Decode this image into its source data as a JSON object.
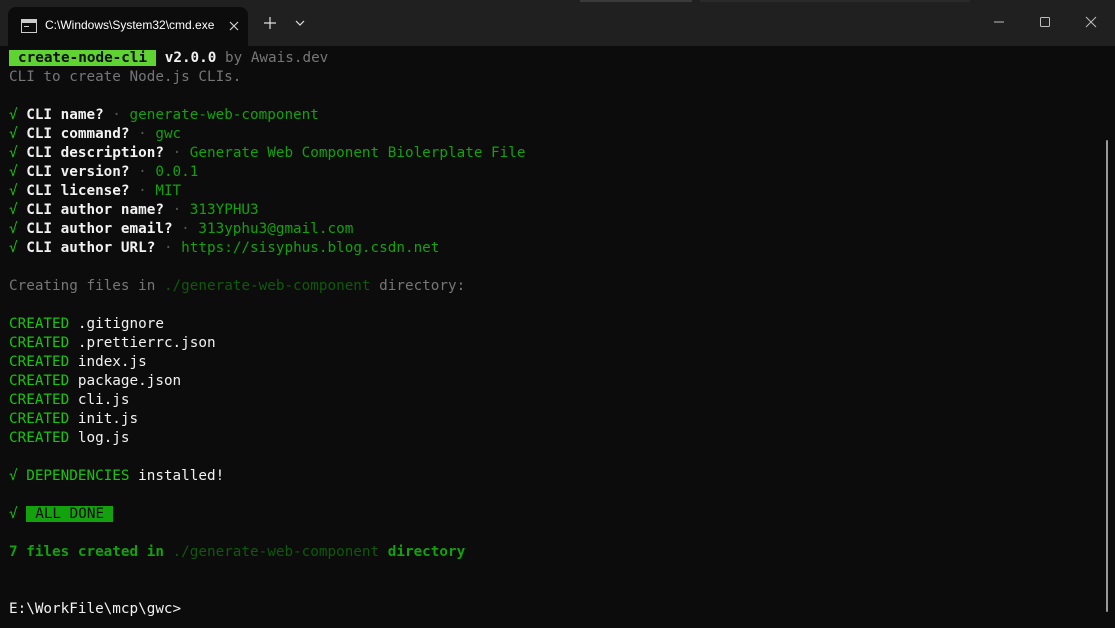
{
  "window": {
    "tab_title": "C:\\Windows\\System32\\cmd.exe",
    "new_tab_icon": "plus-icon",
    "dropdown_icon": "chevron-down-icon",
    "controls": [
      "minimize-icon",
      "maximize-icon",
      "close-icon"
    ]
  },
  "header": {
    "badge": "create-node-cli",
    "version": "v2.0.0",
    "by": " by Awais.dev",
    "description": "CLI to create Node.js CLIs."
  },
  "prompts": [
    {
      "check": "√",
      "question": "CLI name?",
      "sep": "·",
      "answer": "generate-web-component"
    },
    {
      "check": "√",
      "question": "CLI command?",
      "sep": "·",
      "answer": "gwc"
    },
    {
      "check": "√",
      "question": "CLI description?",
      "sep": "·",
      "answer": "Generate Web Component Biolerplate File"
    },
    {
      "check": "√",
      "question": "CLI version?",
      "sep": "·",
      "answer": "0.0.1"
    },
    {
      "check": "√",
      "question": "CLI license?",
      "sep": "·",
      "answer": "MIT"
    },
    {
      "check": "√",
      "question": "CLI author name?",
      "sep": "·",
      "answer": "313YPHU3"
    },
    {
      "check": "√",
      "question": "CLI author email?",
      "sep": "·",
      "answer": "313yphu3@gmail.com"
    },
    {
      "check": "√",
      "question": "CLI author URL?",
      "sep": "·",
      "answer": "https://sisyphus.blog.csdn.net"
    }
  ],
  "creating": {
    "prefix": "Creating files in",
    "path": "./generate-web-component",
    "suffix": "directory:"
  },
  "created": {
    "label": "CREATED",
    "files": [
      ".gitignore",
      ".prettierrc.json",
      "index.js",
      "package.json",
      "cli.js",
      "init.js",
      "log.js"
    ]
  },
  "dependencies": {
    "check": "√",
    "label": "DEPENDENCIES",
    "suffix": "installed!"
  },
  "done": {
    "check": "√",
    "badge": "ALL DONE"
  },
  "summary": {
    "prefix": "7 files created in",
    "path": "./generate-web-component",
    "suffix": "directory"
  },
  "prompt_line": "E:\\WorkFile\\mcp\\gwc>",
  "colors": {
    "background": "#0c0c0c",
    "titlebar": "#202020",
    "green": "#13a10e",
    "bright_green": "#16c60c",
    "badge_green": "#5fd331",
    "text": "#cccccc"
  }
}
